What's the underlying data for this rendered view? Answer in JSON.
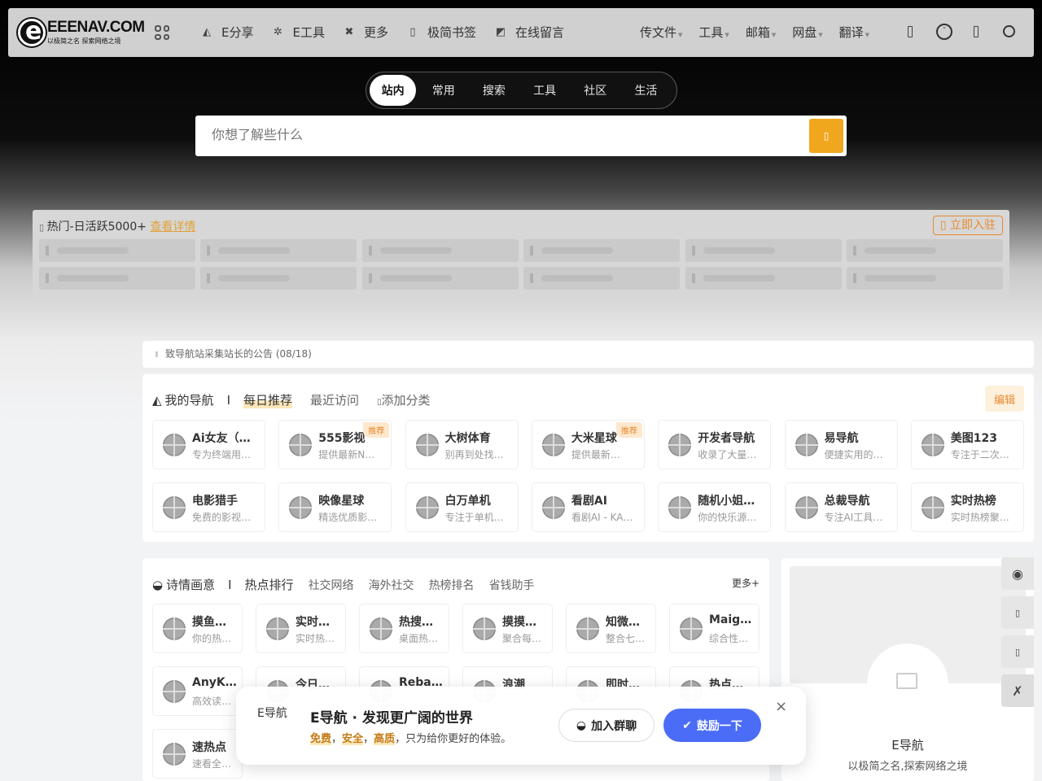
{
  "header": {
    "logo_text": "EEENAV.COM",
    "logo_sub": "以极简之名 探索网络之境",
    "nav": [
      "E分享",
      "E工具",
      "更多",
      "极简书签",
      "在线留言"
    ],
    "nav_icons": [
      "triangle-icon",
      "gear-icon",
      "shuffle-icon",
      "bookmark-icon",
      "edit-icon"
    ],
    "right_nav": [
      "传文件",
      "工具",
      "邮箱",
      "网盘",
      "翻译"
    ]
  },
  "search": {
    "tabs": [
      "站内",
      "常用",
      "搜索",
      "工具",
      "社区",
      "生活"
    ],
    "active_tab": 0,
    "placeholder": "你想了解些什么"
  },
  "hot": {
    "title": "热门-日活跃5000+",
    "link": "查看详情",
    "join": "立即入驻"
  },
  "notice": {
    "text": "致导航站采集站长的公告 (08/18)"
  },
  "mynav": {
    "tabs": [
      "我的导航",
      "每日推荐",
      "最近访问",
      "添加分类"
    ],
    "edit": "编辑",
    "cards": [
      {
        "title": "Ai女友（…",
        "desc": "专为终端用…",
        "badge": ""
      },
      {
        "title": "555影视",
        "desc": "提供最新N…",
        "badge": "推荐"
      },
      {
        "title": "大树体育",
        "desc": "别再到处找…",
        "badge": ""
      },
      {
        "title": "大米星球",
        "desc": "提供最新…",
        "badge": "推荐"
      },
      {
        "title": "开发者导航",
        "desc": "收录了大量…",
        "badge": ""
      },
      {
        "title": "易导航",
        "desc": "便捷实用的…",
        "badge": ""
      },
      {
        "title": "美图123",
        "desc": "专注于二次…",
        "badge": ""
      },
      {
        "title": "电影猎手",
        "desc": "免费的影视…",
        "badge": ""
      },
      {
        "title": "映像星球",
        "desc": "精选优质影…",
        "badge": ""
      },
      {
        "title": "白万单机",
        "desc": "专注于单机…",
        "badge": ""
      },
      {
        "title": "看剧AI",
        "desc": "看剧AI - KA…",
        "badge": ""
      },
      {
        "title": "随机小姐…",
        "desc": "你的快乐源…",
        "badge": ""
      },
      {
        "title": "总裁导航",
        "desc": "专注AI工具…",
        "badge": ""
      },
      {
        "title": "实时热榜",
        "desc": "实时热榜聚…",
        "badge": ""
      }
    ]
  },
  "poem": {
    "tabs": [
      "诗情画意",
      "热点排行",
      "社交网络",
      "海外社交",
      "热榜排名",
      "省钱助手"
    ],
    "more": "更多+",
    "cards": [
      {
        "title": "摸鱼…",
        "desc": "你的热…"
      },
      {
        "title": "实时…",
        "desc": "实时热…"
      },
      {
        "title": "热搜…",
        "desc": "桌面热…"
      },
      {
        "title": "摸摸…",
        "desc": "聚合每…"
      },
      {
        "title": "知微…",
        "desc": "整合七…"
      },
      {
        "title": "Maigoo",
        "desc": "综合性…"
      },
      {
        "title": "AnyK…",
        "desc": "高效读…"
      },
      {
        "title": "今日…",
        "desc": ""
      },
      {
        "title": "Reba…",
        "desc": ""
      },
      {
        "title": "浪潮",
        "desc": ""
      },
      {
        "title": "即时…",
        "desc": ""
      },
      {
        "title": "热点…",
        "desc": ""
      },
      {
        "title": "速热点",
        "desc": "速看全…"
      }
    ]
  },
  "side": {
    "name": "E导航",
    "desc": "以极简之名,探索网络之境"
  },
  "popup": {
    "img_alt": "E导航",
    "title": "E导航 · 发现更广阔的世界",
    "hl1": "免费",
    "hl2": "安全",
    "hl3": "高质",
    "sep": "，",
    "rest": "，只为给你更好的体验。",
    "chat": "加入群聊",
    "donate": "鼓励一下",
    "close": "×"
  }
}
